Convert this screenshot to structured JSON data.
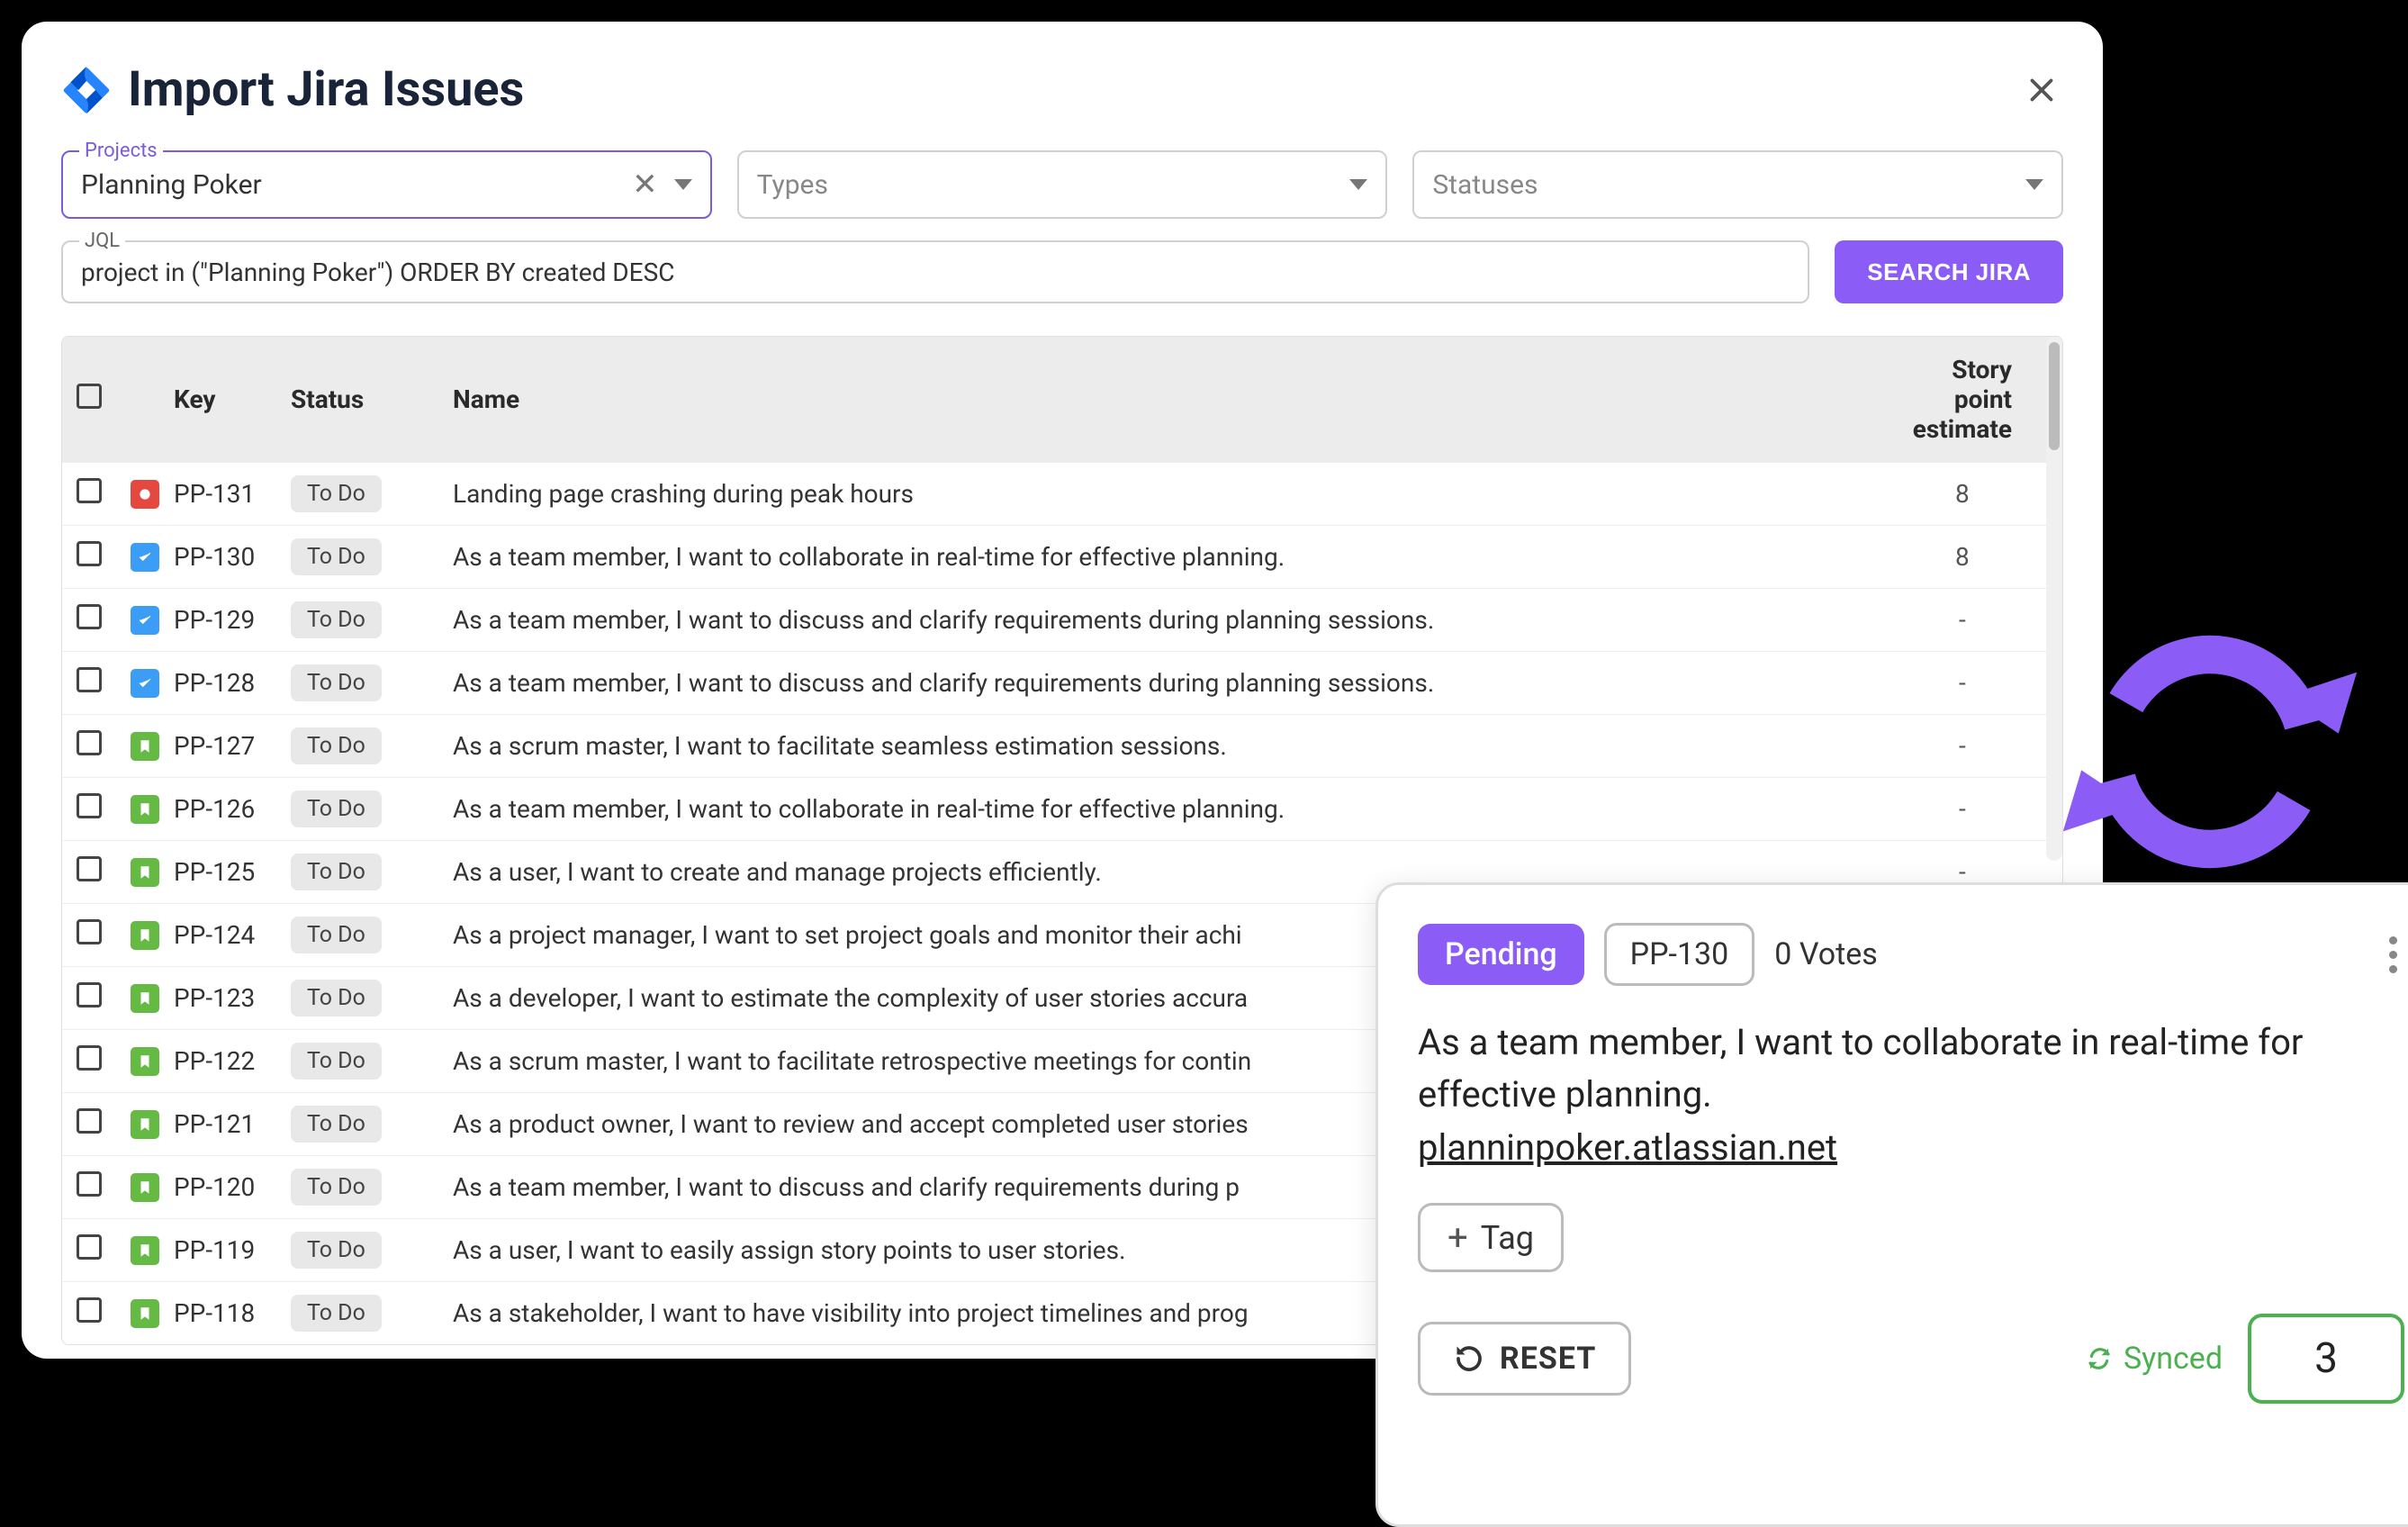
{
  "modal": {
    "title": "Import Jira Issues",
    "filters": {
      "projects": {
        "label": "Projects",
        "value": "Planning Poker"
      },
      "types": {
        "placeholder": "Types"
      },
      "statuses": {
        "placeholder": "Statuses"
      }
    },
    "jql": {
      "label": "JQL",
      "value": "project in (\"Planning Poker\") ORDER BY created DESC"
    },
    "search_button": "SEARCH JIRA",
    "columns": {
      "key": "Key",
      "status": "Status",
      "name": "Name",
      "sp": "Story point estimate"
    }
  },
  "issues": [
    {
      "icon": "bug",
      "key": "PP-131",
      "status": "To Do",
      "name": "Landing page crashing during peak hours",
      "sp": "8"
    },
    {
      "icon": "task",
      "key": "PP-130",
      "status": "To Do",
      "name": "As a team member, I want to collaborate in real-time for effective planning.",
      "sp": "8"
    },
    {
      "icon": "task",
      "key": "PP-129",
      "status": "To Do",
      "name": "As a team member, I want to discuss and clarify requirements during planning sessions.",
      "sp": "-"
    },
    {
      "icon": "task",
      "key": "PP-128",
      "status": "To Do",
      "name": "As a team member, I want to discuss and clarify requirements during planning sessions.",
      "sp": "-"
    },
    {
      "icon": "story",
      "key": "PP-127",
      "status": "To Do",
      "name": "As a scrum master, I want to facilitate seamless estimation sessions.",
      "sp": "-"
    },
    {
      "icon": "story",
      "key": "PP-126",
      "status": "To Do",
      "name": "As a team member, I want to collaborate in real-time for effective planning.",
      "sp": "-"
    },
    {
      "icon": "story",
      "key": "PP-125",
      "status": "To Do",
      "name": "As a user, I want to create and manage projects efficiently.",
      "sp": "-"
    },
    {
      "icon": "story",
      "key": "PP-124",
      "status": "To Do",
      "name": "As a project manager, I want to set project goals and monitor their achi",
      "sp": ""
    },
    {
      "icon": "story",
      "key": "PP-123",
      "status": "To Do",
      "name": "As a developer, I want to estimate the complexity of user stories accura",
      "sp": ""
    },
    {
      "icon": "story",
      "key": "PP-122",
      "status": "To Do",
      "name": "As a scrum master, I want to facilitate retrospective meetings for contin",
      "sp": ""
    },
    {
      "icon": "story",
      "key": "PP-121",
      "status": "To Do",
      "name": "As a product owner, I want to review and accept completed user stories",
      "sp": ""
    },
    {
      "icon": "story",
      "key": "PP-120",
      "status": "To Do",
      "name": "As a team member, I want to discuss and clarify requirements during p",
      "sp": ""
    },
    {
      "icon": "story",
      "key": "PP-119",
      "status": "To Do",
      "name": "As a user, I want to easily assign story points to user stories.",
      "sp": ""
    },
    {
      "icon": "story",
      "key": "PP-118",
      "status": "To Do",
      "name": "As a stakeholder, I want to have visibility into project timelines and prog",
      "sp": ""
    }
  ],
  "card": {
    "status": "Pending",
    "key": "PP-130",
    "votes": "0 Votes",
    "title": "As a team member, I want to collaborate in real-time for effective planning.",
    "link": "planninpoker.atlassian.net",
    "tag_label": "Tag",
    "reset_label": "RESET",
    "synced_label": "Synced",
    "score": "3"
  },
  "colors": {
    "accent": "#8b5cf6",
    "success": "#4caf50"
  }
}
